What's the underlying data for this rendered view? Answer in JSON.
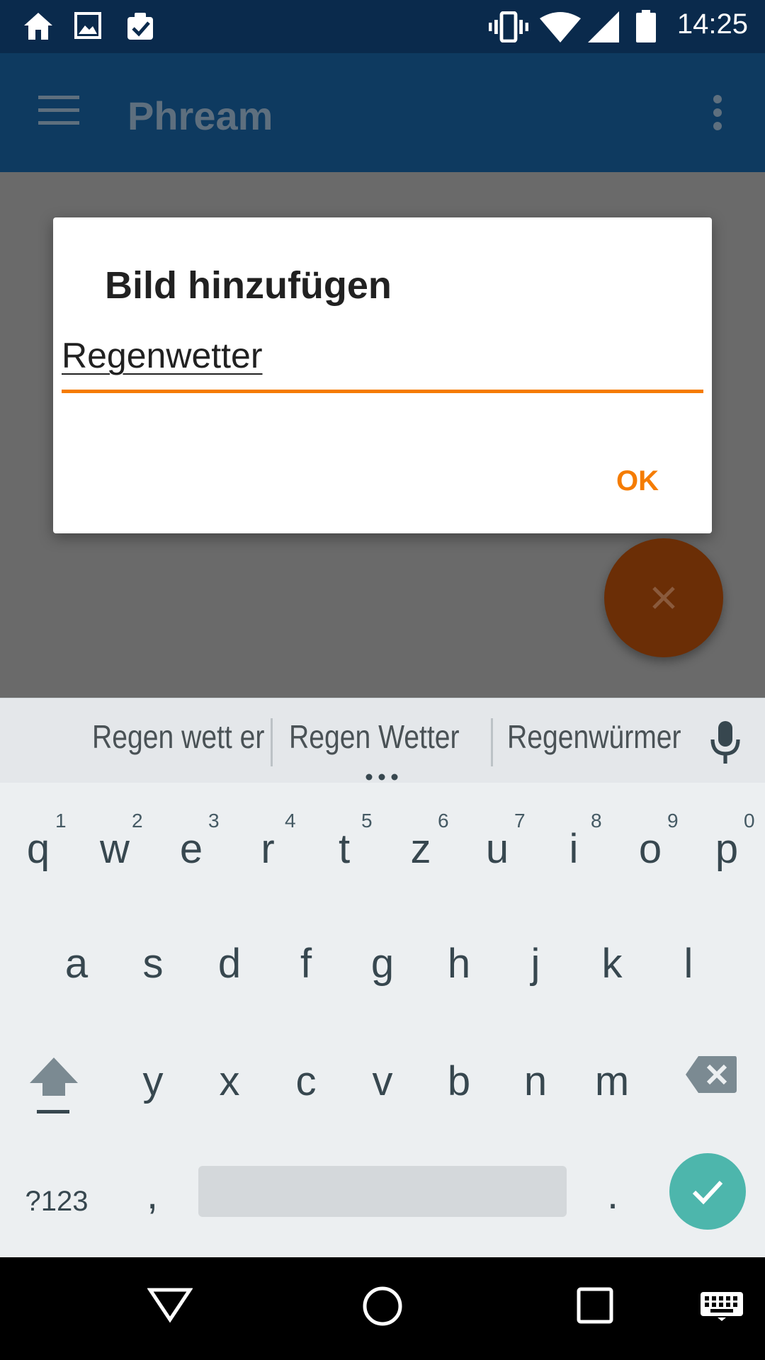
{
  "status_bar": {
    "time": "14:25",
    "icons": [
      "home-icon",
      "image-icon",
      "clipboard-check-icon",
      "vibrate-icon",
      "wifi-icon",
      "signal-icon",
      "battery-icon"
    ]
  },
  "app_bar": {
    "title": "Phream",
    "menu_icon": "hamburger-menu-icon",
    "overflow_icon": "more-vert-icon"
  },
  "dialog": {
    "title": "Bild hinzufügen",
    "input_value": "Regenwetter",
    "ok_label": "OK"
  },
  "fab": {
    "icon": "close-icon"
  },
  "suggestions": [
    "Regen wett er",
    "Regen Wetter",
    "Regenwürmer"
  ],
  "keyboard": {
    "row1": [
      {
        "key": "q",
        "num": "1"
      },
      {
        "key": "w",
        "num": "2"
      },
      {
        "key": "e",
        "num": "3"
      },
      {
        "key": "r",
        "num": "4"
      },
      {
        "key": "t",
        "num": "5"
      },
      {
        "key": "z",
        "num": "6"
      },
      {
        "key": "u",
        "num": "7"
      },
      {
        "key": "i",
        "num": "8"
      },
      {
        "key": "o",
        "num": "9"
      },
      {
        "key": "p",
        "num": "0"
      }
    ],
    "row2": [
      "a",
      "s",
      "d",
      "f",
      "g",
      "h",
      "j",
      "k",
      "l"
    ],
    "row3": [
      "y",
      "x",
      "c",
      "v",
      "b",
      "n",
      "m"
    ],
    "symbols_label": "?123",
    "comma": ",",
    "period": "."
  },
  "colors": {
    "status_bar": "#0a2a4c",
    "app_bar": "#0e3a60",
    "accent": "#f57c00",
    "enter_key": "#4db6ac"
  }
}
